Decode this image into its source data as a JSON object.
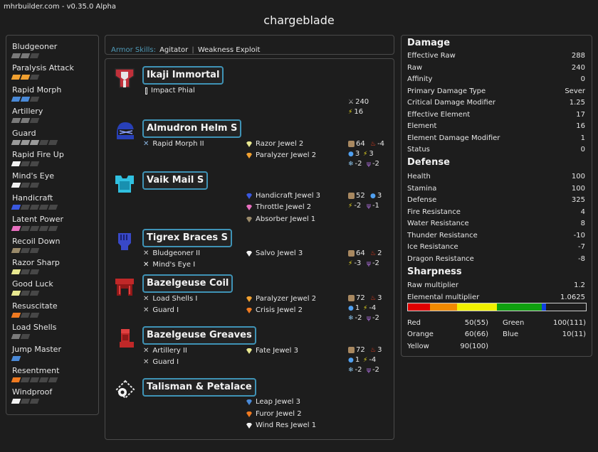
{
  "app": {
    "version": "mhrbuilder.com - v0.35.0 Alpha",
    "title": "chargeblade"
  },
  "skills": [
    {
      "name": "Bludgeoner",
      "pips": [
        "#7a7a7a",
        "#7a7a7a",
        "#474747"
      ]
    },
    {
      "name": "Paralysis Attack",
      "pips": [
        "#f0a030",
        "#f0a030",
        "#474747"
      ]
    },
    {
      "name": "Rapid Morph",
      "pips": [
        "#4a8ad8",
        "#4a8ad8",
        "#474747"
      ]
    },
    {
      "name": "Artillery",
      "pips": [
        "#7a7a7a",
        "#7a7a7a",
        "#474747"
      ]
    },
    {
      "name": "Guard",
      "pips": [
        "#9a9a9a",
        "#9a9a9a",
        "#9a9a9a",
        "#474747",
        "#474747"
      ]
    },
    {
      "name": "Rapid Fire Up",
      "pips": [
        "#f2f2f2",
        "#474747",
        "#474747"
      ]
    },
    {
      "name": "Mind's Eye",
      "pips": [
        "#f2f2f2",
        "#474747",
        "#474747"
      ]
    },
    {
      "name": "Handicraft",
      "pips": [
        "#3a58e0",
        "#474747",
        "#474747",
        "#474747",
        "#474747"
      ]
    },
    {
      "name": "Latent Power",
      "pips": [
        "#e870c0",
        "#474747",
        "#474747",
        "#474747",
        "#474747"
      ]
    },
    {
      "name": "Recoil Down",
      "pips": [
        "#9a8a6a",
        "#474747",
        "#474747"
      ]
    },
    {
      "name": "Razor Sharp",
      "pips": [
        "#e8e890",
        "#474747",
        "#474747"
      ]
    },
    {
      "name": "Good Luck",
      "pips": [
        "#e8e890",
        "#474747",
        "#474747"
      ]
    },
    {
      "name": "Resuscitate",
      "pips": [
        "#f07a20",
        "#474747",
        "#474747"
      ]
    },
    {
      "name": "Load Shells",
      "pips": [
        "#7a7a7a",
        "#474747"
      ]
    },
    {
      "name": "Jump Master",
      "pips": [
        "#4a8ad8"
      ]
    },
    {
      "name": "Resentment",
      "pips": [
        "#f07a20",
        "#474747",
        "#474747",
        "#474747",
        "#474747"
      ]
    },
    {
      "name": "Windproof",
      "pips": [
        "#f2f2f2",
        "#474747",
        "#474747"
      ]
    }
  ],
  "armor_skills": {
    "label": "Armor Skills:",
    "first": "Agitator",
    "sep": "|",
    "second": "Weakness Exploit"
  },
  "equipment": {
    "weapon": {
      "name": "Ikaji Immortal",
      "skill": "Impact Phial",
      "attack": "240",
      "element": "16"
    },
    "helm": {
      "name": "Almudron Helm S",
      "skill": "Rapid Morph II",
      "jewel1": "Razor Jewel 2",
      "jewel2": "Paralyzer Jewel 2",
      "def": "64",
      "fire": "-4",
      "water": "3",
      "thunder": "3",
      "ice": "-2",
      "dragon": "-2"
    },
    "mail": {
      "name": "Vaik Mail S",
      "jewel1": "Handicraft Jewel 3",
      "jewel2": "Throttle Jewel 2",
      "jewel3": "Absorber Jewel 1",
      "def": "52",
      "water": "3",
      "thunder": "-2",
      "dragon": "-1"
    },
    "braces": {
      "name": "Tigrex Braces S",
      "skill1": "Bludgeoner II",
      "skill2": "Mind's Eye I",
      "jewel1": "Salvo Jewel 3",
      "def": "64",
      "fire": "2",
      "thunder": "-3",
      "dragon": "-2"
    },
    "coil": {
      "name": "Bazelgeuse Coil",
      "skill1": "Load Shells I",
      "skill2": "Guard I",
      "jewel1": "Paralyzer Jewel 2",
      "jewel2": "Crisis Jewel 2",
      "def": "72",
      "fire": "3",
      "water": "1",
      "thunder": "-4",
      "ice": "-2",
      "dragon": "-2"
    },
    "greaves": {
      "name": "Bazelgeuse Greaves",
      "skill1": "Artillery II",
      "skill2": "Guard I",
      "jewel1": "Fate Jewel 3",
      "def": "72",
      "fire": "3",
      "water": "1",
      "thunder": "-4",
      "ice": "-2",
      "dragon": "-2"
    },
    "talisman": {
      "name": "Talisman & Petalace",
      "jewel1": "Leap Jewel 3",
      "jewel2": "Furor Jewel 2",
      "jewel3": "Wind Res Jewel 1"
    }
  },
  "stats": {
    "damage_title": "Damage",
    "damage": [
      {
        "label": "Effective Raw",
        "value": "288"
      },
      {
        "label": "Raw",
        "value": "240"
      },
      {
        "label": "Affinity",
        "value": "0"
      },
      {
        "label": "Primary Damage Type",
        "value": "Sever"
      },
      {
        "label": "Critical Damage Modifier",
        "value": "1.25"
      },
      {
        "label": "Effective Element",
        "value": "17"
      },
      {
        "label": "Element",
        "value": "16"
      },
      {
        "label": "Element Damage Modifier",
        "value": "1"
      },
      {
        "label": "Status",
        "value": "0"
      }
    ],
    "defense_title": "Defense",
    "defense": [
      {
        "label": "Health",
        "value": "100"
      },
      {
        "label": "Stamina",
        "value": "100"
      },
      {
        "label": "Defense",
        "value": "325"
      },
      {
        "label": "Fire Resistance",
        "value": "4"
      },
      {
        "label": "Water Resistance",
        "value": "8"
      },
      {
        "label": "Thunder Resistance",
        "value": "-10"
      },
      {
        "label": "Ice Resistance",
        "value": "-7"
      },
      {
        "label": "Dragon Resistance",
        "value": "-8"
      }
    ],
    "sharpness_title": "Sharpness",
    "sharpness": [
      {
        "label": "Raw multiplier",
        "value": "1.2"
      },
      {
        "label": "Elemental multiplier",
        "value": "1.0625"
      }
    ],
    "sharpness_bar": [
      {
        "color": "#e00000",
        "value": 50
      },
      {
        "color": "#f08a00",
        "value": 60
      },
      {
        "color": "#f0f000",
        "value": 90
      },
      {
        "color": "#10a010",
        "value": 100
      },
      {
        "color": "#1040e0",
        "value": 10
      }
    ],
    "sharpness_values": {
      "red_label": "Red",
      "red": "50(55)",
      "orange_label": "Orange",
      "orange": "60(66)",
      "yellow_label": "Yellow",
      "yellow": "90(100)",
      "green_label": "Green",
      "green": "100(111)",
      "blue_label": "Blue",
      "blue": "10(11)"
    }
  },
  "colors": {
    "accent": "#3f93b6",
    "armor_skills_label": "#4f9ab8"
  }
}
